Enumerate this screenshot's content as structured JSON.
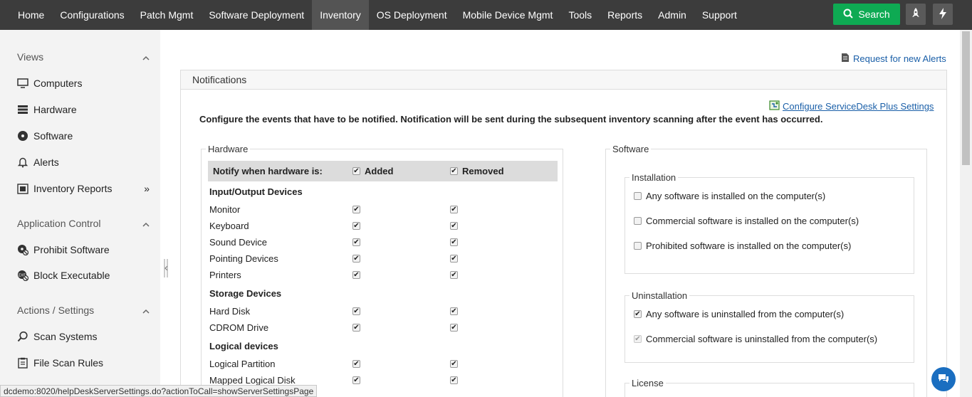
{
  "topnav": {
    "items": [
      "Home",
      "Configurations",
      "Patch Mgmt",
      "Software Deployment",
      "Inventory",
      "OS Deployment",
      "Mobile Device Mgmt",
      "Tools",
      "Reports",
      "Admin",
      "Support"
    ],
    "active": "Inventory",
    "search_label": "Search"
  },
  "sidebar": {
    "views_label": "Views",
    "views_items": [
      "Computers",
      "Hardware",
      "Software",
      "Alerts",
      "Inventory Reports"
    ],
    "app_control_label": "Application Control",
    "app_control_items": [
      "Prohibit Software",
      "Block Executable"
    ],
    "actions_label": "Actions / Settings",
    "actions_items": [
      "Scan Systems",
      "File Scan Rules"
    ],
    "more_glyph": "»"
  },
  "header": {
    "request_link": "Request for new Alerts",
    "panel_title": "Notifications",
    "sdp_link": "Configure ServiceDesk Plus Settings",
    "description": "Configure the events that have to be notified. Notification will be sent during the subsequent inventory scanning after the event has occurred."
  },
  "hardware": {
    "legend": "Hardware",
    "notify_label": "Notify when hardware is:",
    "added_label": "Added",
    "removed_label": "Removed",
    "added_checked": true,
    "removed_checked": true,
    "groups": [
      {
        "name": "Input/Output Devices",
        "rows": [
          "Monitor",
          "Keyboard",
          "Sound Device",
          "Pointing Devices",
          "Printers"
        ]
      },
      {
        "name": "Storage Devices",
        "rows": [
          "Hard Disk",
          "CDROM Drive"
        ]
      },
      {
        "name": "Logical devices",
        "rows": [
          "Logical Partition",
          "Mapped Logical Disk"
        ]
      }
    ]
  },
  "software": {
    "legend": "Software",
    "installation_legend": "Installation",
    "installation": [
      {
        "label": "Any software is installed on the computer(s)",
        "checked": false
      },
      {
        "label": "Commercial software is installed on the computer(s)",
        "checked": false
      },
      {
        "label": "Prohibited software is installed on the computer(s)",
        "checked": false
      }
    ],
    "uninstallation_legend": "Uninstallation",
    "uninstallation": [
      {
        "label": "Any software is uninstalled from the computer(s)",
        "checked": true
      },
      {
        "label": "Commercial software is uninstalled from the computer(s)",
        "checked": true
      }
    ],
    "license_legend": "License"
  },
  "status_bar": "dcdemo:8020/helpDeskServerSettings.do?actionToCall=showServerSettingsPage",
  "colors": {
    "nav_bg": "#3c3c3c",
    "accent_green": "#0eaa53",
    "link_blue": "#1a5fa8"
  }
}
